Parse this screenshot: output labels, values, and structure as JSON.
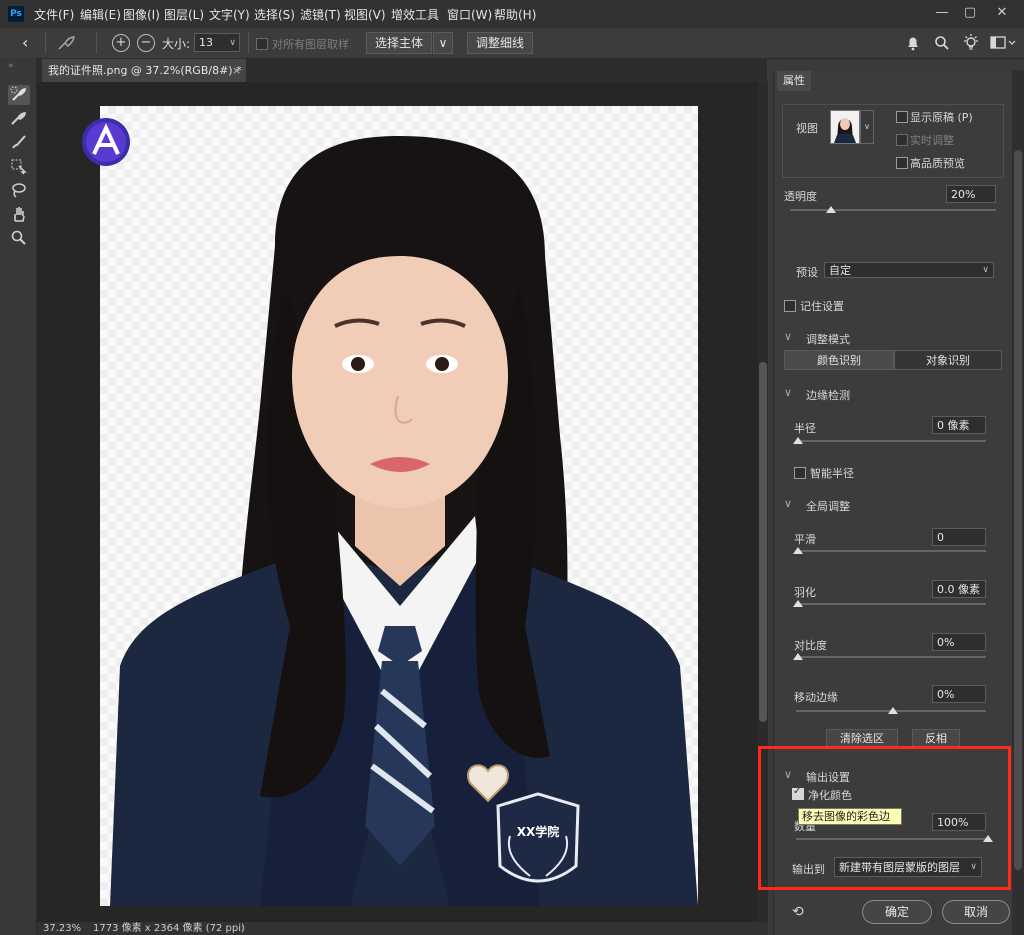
{
  "app": {
    "logo": "Ps"
  },
  "menu": [
    "文件(F)",
    "编辑(E)",
    "图像(I)",
    "图层(L)",
    "文字(Y)",
    "选择(S)",
    "滤镜(T)",
    "视图(V)",
    "增效工具",
    "窗口(W)",
    "帮助(H)"
  ],
  "options_bar": {
    "size_label": "大小:",
    "size_value": "13",
    "sample_all_label": "对所有图层取样",
    "select_subject": "选择主体",
    "refine_hair": "调整细线"
  },
  "document": {
    "tab_title": "我的证件照.png @ 37.2%(RGB/8#) *",
    "tab_close": "×",
    "zoom": "37.23%",
    "dimensions": "1773 像素 x 2364 像素 (72 ppi)"
  },
  "badge": {
    "crest_text": "XX学院"
  },
  "panel": {
    "tab": "属性",
    "view_label": "视图",
    "show_original": "显示原稿 (P)",
    "realtime_refine": "实时调整",
    "high_quality_preview": "高品质预览",
    "opacity_label": "透明度",
    "opacity_value": "20%",
    "preset_label": "预设",
    "preset_value": "自定",
    "remember_settings": "记住设置",
    "refine_mode_header": "调整模式",
    "mode_color": "颜色识别",
    "mode_object": "对象识别",
    "edge_detection_header": "边缘检测",
    "radius_label": "半径",
    "radius_value": "0 像素",
    "smart_radius": "智能半径",
    "global_header": "全局调整",
    "smooth_label": "平滑",
    "smooth_value": "0",
    "feather_label": "羽化",
    "feather_value": "0.0 像素",
    "contrast_label": "对比度",
    "contrast_value": "0%",
    "shift_edge_label": "移动边缘",
    "shift_edge_value": "0%",
    "clear_selection": "清除选区",
    "invert": "反相",
    "output_header": "输出设置",
    "decontaminate": "净化颜色",
    "amount_label": "数量",
    "amount_value": "100%",
    "tooltip": "移去图像的彩色边",
    "output_to_label": "输出到",
    "output_to_value": "新建带有图层蒙版的图层",
    "ok": "确定",
    "cancel": "取消"
  },
  "levels": {
    "opacity": 0.2,
    "radius": 0,
    "smooth": 0,
    "feather": 0,
    "contrast": 0,
    "shift_edge": 0.5,
    "amount": 1.0
  },
  "colors": {
    "highlight": "#ff2a1a",
    "tooltip_bg": "#fdfdb8",
    "blazer": "#1c2740"
  }
}
